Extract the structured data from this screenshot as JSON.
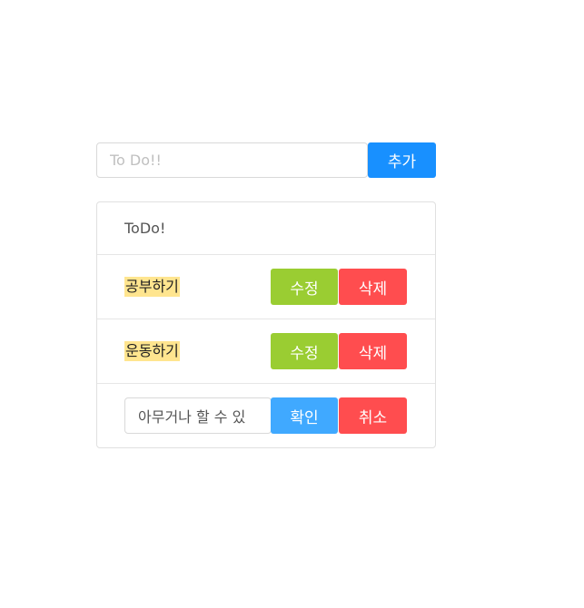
{
  "add_form": {
    "placeholder": "To Do!!",
    "value": "",
    "add_label": "추가"
  },
  "list": {
    "header": "ToDo!",
    "items": [
      {
        "text": "공부하기",
        "edit_label": "수정",
        "delete_label": "삭제"
      },
      {
        "text": "운동하기",
        "edit_label": "수정",
        "delete_label": "삭제"
      }
    ],
    "editing_item": {
      "value": "아무거나 할 수 있",
      "confirm_label": "확인",
      "cancel_label": "취소"
    }
  },
  "colors": {
    "primary": "#1890ff",
    "edit": "#9acd32",
    "delete": "#ff4d4f",
    "confirm": "#40a9ff",
    "highlight": "#ffe58f"
  }
}
